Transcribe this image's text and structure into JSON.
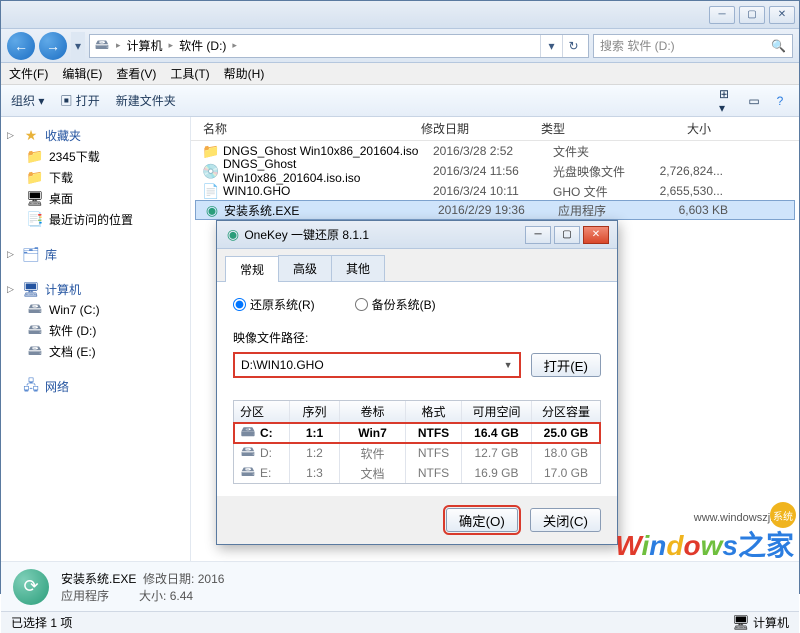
{
  "breadcrumb": {
    "root": "计算机",
    "drive": "软件 (D:)"
  },
  "search": {
    "placeholder": "搜索 软件 (D:)"
  },
  "menus": {
    "file": "文件(F)",
    "edit": "编辑(E)",
    "view": "查看(V)",
    "tools": "工具(T)",
    "help": "帮助(H)"
  },
  "toolbar": {
    "organize": "组织 ▾",
    "open": "打开",
    "newfolder": "新建文件夹"
  },
  "sidebar": {
    "fav": {
      "label": "收藏夹",
      "items": [
        "2345下载",
        "下载",
        "桌面",
        "最近访问的位置"
      ]
    },
    "lib": {
      "label": "库"
    },
    "computer": {
      "label": "计算机",
      "drives": [
        "Win7 (C:)",
        "软件 (D:)",
        "文档 (E:)"
      ]
    },
    "network": {
      "label": "网络"
    }
  },
  "columns": {
    "name": "名称",
    "date": "修改日期",
    "type": "类型",
    "size": "大小"
  },
  "files": [
    {
      "name": "DNGS_Ghost Win10x86_201604.iso",
      "date": "2016/3/28 2:52",
      "type": "文件夹",
      "size": ""
    },
    {
      "name": "DNGS_Ghost Win10x86_201604.iso.iso",
      "date": "2016/3/24 11:56",
      "type": "光盘映像文件",
      "size": "2,726,824..."
    },
    {
      "name": "WIN10.GHO",
      "date": "2016/3/24 10:11",
      "type": "GHO 文件",
      "size": "2,655,530..."
    },
    {
      "name": "安装系统.EXE",
      "date": "2016/2/29 19:36",
      "type": "应用程序",
      "size": "6,603 KB"
    }
  ],
  "details": {
    "name": "安装系统.EXE",
    "type": "应用程序",
    "date_label": "修改日期:",
    "date": "2016",
    "size_label": "大小:",
    "size": "6.44"
  },
  "status": {
    "left": "已选择 1 项",
    "right": "计算机"
  },
  "dialog": {
    "title": "OneKey 一键还原 8.1.1",
    "tabs": {
      "general": "常规",
      "advanced": "高级",
      "other": "其他"
    },
    "radio_restore": "还原系统(R)",
    "radio_backup": "备份系统(B)",
    "path_label": "映像文件路径:",
    "path_value": "D:\\WIN10.GHO",
    "open_btn": "打开(E)",
    "pt_headers": {
      "part": "分区",
      "seq": "序列",
      "label": "卷标",
      "fs": "格式",
      "free": "可用空间",
      "total": "分区容量"
    },
    "partitions": [
      {
        "part": "C:",
        "seq": "1:1",
        "label": "Win7",
        "fs": "NTFS",
        "free": "16.4 GB",
        "total": "25.0 GB"
      },
      {
        "part": "D:",
        "seq": "1:2",
        "label": "软件",
        "fs": "NTFS",
        "free": "12.7 GB",
        "total": "18.0 GB"
      },
      {
        "part": "E:",
        "seq": "1:3",
        "label": "文档",
        "fs": "NTFS",
        "free": "16.9 GB",
        "total": "17.0 GB"
      }
    ],
    "ok_btn": "确定(O)",
    "close_btn": "关闭(C)"
  },
  "watermark": {
    "url": "www.windowszj.com",
    "tail": "之家",
    "badge": "系统"
  }
}
